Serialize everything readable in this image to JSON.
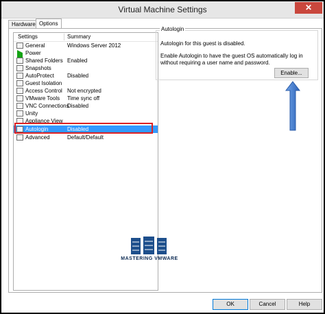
{
  "window": {
    "title": "Virtual Machine Settings",
    "close_glyph": "✕"
  },
  "tabs": [
    {
      "label": "Hardware"
    },
    {
      "label": "Options"
    }
  ],
  "settings_list": {
    "headers": {
      "settings": "Settings",
      "summary": "Summary"
    },
    "items": [
      {
        "icon": "general-icon",
        "label": "General",
        "summary": "Windows Server 2012"
      },
      {
        "icon": "power-icon",
        "label": "Power",
        "summary": ""
      },
      {
        "icon": "shared-folders-icon",
        "label": "Shared Folders",
        "summary": "Enabled"
      },
      {
        "icon": "snapshots-icon",
        "label": "Snapshots",
        "summary": ""
      },
      {
        "icon": "autoprotect-icon",
        "label": "AutoProtect",
        "summary": "Disabled"
      },
      {
        "icon": "guest-isolation-icon",
        "label": "Guest Isolation",
        "summary": ""
      },
      {
        "icon": "access-control-icon",
        "label": "Access Control",
        "summary": "Not encrypted"
      },
      {
        "icon": "vmware-tools-icon",
        "label": "VMware Tools",
        "summary": "Time sync off"
      },
      {
        "icon": "vnc-connections-icon",
        "label": "VNC Connections",
        "summary": "Disabled"
      },
      {
        "icon": "unity-icon",
        "label": "Unity",
        "summary": ""
      },
      {
        "icon": "appliance-view-icon",
        "label": "Appliance View",
        "summary": ""
      },
      {
        "icon": "autologin-icon",
        "label": "Autologin",
        "summary": "Disabled"
      },
      {
        "icon": "advanced-icon",
        "label": "Advanced",
        "summary": "Default/Default"
      }
    ],
    "selected_index": 11
  },
  "autologin": {
    "group_label": "Autologin",
    "status": "Autologin for this guest is disabled.",
    "description": "Enable Autologin to have the guest OS automatically log in without requiring a user name and password.",
    "enable_label": "Enable..."
  },
  "watermark": {
    "text": "MASTERING VMWARE"
  },
  "footer": {
    "ok_label": "OK",
    "cancel_label": "Cancel",
    "help_label": "Help"
  },
  "colors": {
    "selection": "#3399ff",
    "highlight": "#e02020",
    "arrow": "#3b7bd0",
    "close": "#c9473d"
  }
}
